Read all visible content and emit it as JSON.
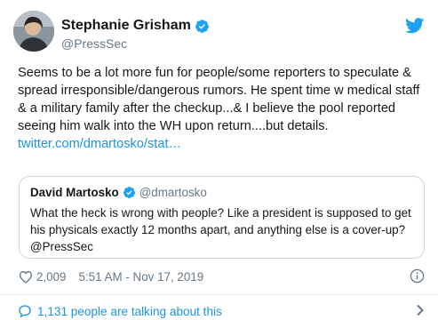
{
  "author": {
    "name": "Stephanie Grisham",
    "handle": "@PressSec"
  },
  "tweet": {
    "text": "Seems to be a lot more fun for people/some reporters to speculate & spread irresponsible/dangerous rumors. He spent time w medical staff & a military family after the checkup...& I believe the pool reported seeing him walk into the WH upon return....but details. ",
    "link": "twitter.com/dmartosko/stat…"
  },
  "quoted": {
    "name": "David Martosko",
    "handle": "@dmartosko",
    "text": "What the heck is wrong with people? Like a president is supposed to get his physicals exactly 12 months apart, and anything else is a cover-up?  @PressSec"
  },
  "meta": {
    "likes": "2,009",
    "timestamp": "5:51 AM - Nov 17, 2019"
  },
  "footer": {
    "talking": "1,131 people are talking about this"
  },
  "colors": {
    "link": "#1b95e0",
    "verified": "#1da1f2",
    "muted": "#657786",
    "border": "#ccd6dd"
  },
  "icons": [
    "verified-badge-icon",
    "twitter-bird-icon",
    "heart-icon",
    "info-icon",
    "speech-bubble-icon",
    "chevron-right-icon"
  ]
}
